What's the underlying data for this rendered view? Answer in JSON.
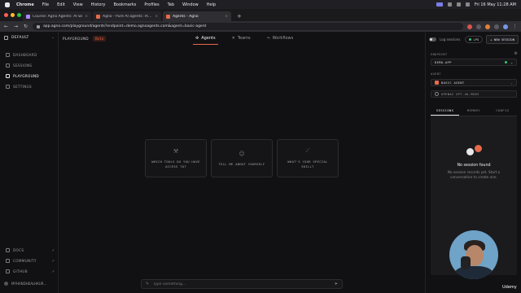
{
  "menubar": {
    "app": "Chrome",
    "items": [
      "File",
      "Edit",
      "View",
      "History",
      "Bookmarks",
      "Profiles",
      "Tab",
      "Window",
      "Help"
    ],
    "clock": "Fri 16 May  11:28 AM"
  },
  "browser": {
    "tabs": [
      {
        "title": "Course: Agno Agents: AI wi",
        "favicon_color": "#a78bfa"
      },
      {
        "title": "Agno - Pure AI agents: made",
        "favicon_color": "#e66a4a"
      },
      {
        "title": "Agents - Agno",
        "favicon_color": "#e66a4a",
        "active": true
      }
    ],
    "url": "app.agno.com/playground/agents?endpoint=demo.agnoagents.com&agent=basic-agent"
  },
  "sidebar": {
    "workspace": "DEFAULT",
    "nav": [
      {
        "label": "DASHBOARD",
        "icon": "grid-icon"
      },
      {
        "label": "SESSIONS",
        "icon": "history-icon"
      },
      {
        "label": "PLAYGROUND",
        "icon": "play-icon",
        "active": true
      },
      {
        "label": "SETTINGS",
        "icon": "gear-icon"
      }
    ],
    "links": [
      {
        "label": "DOCS",
        "icon": "docs-icon"
      },
      {
        "label": "COMMUNITY",
        "icon": "community-icon"
      },
      {
        "label": "GITHUB",
        "icon": "github-icon"
      }
    ],
    "user": "MYHANDHEALHKUR..."
  },
  "main": {
    "section": "PLAYGROUND",
    "badge": "Beta",
    "tabs": [
      {
        "label": "Agents",
        "icon": "agents-icon",
        "active": true
      },
      {
        "label": "Teams",
        "icon": "teams-icon"
      },
      {
        "label": "Workflows",
        "icon": "workflows-icon"
      }
    ],
    "suggestions": [
      {
        "text": "WHICH TOOLS DO YOU HAVE ACCESS TO?",
        "icon": "tools-icon"
      },
      {
        "text": "TELL ME ABOUT YOURSELF",
        "icon": "smile-icon"
      },
      {
        "text": "WHAT'S YOUR SPECIAL SKILL?",
        "icon": "sparkle-icon"
      }
    ],
    "chat_placeholder": "Type something..."
  },
  "right": {
    "log_sessions_label": "Log sessions",
    "status_pill": "LPS",
    "new_session": "+ NEW SESSION",
    "endpoint_label": "ENDPOINT",
    "endpoint_value": "DEMO-APP",
    "agent_label": "AGENT",
    "agent_value": "BASIC AGENT",
    "model_value": "OPENAI GPT-4O-MINI",
    "subtabs": [
      {
        "label": "SESSIONS",
        "active": true
      },
      {
        "label": "MEMORY"
      },
      {
        "label": "CONFIG"
      }
    ],
    "empty_title": "No session found",
    "empty_sub": "No session records yet. Start a conversation to create one."
  },
  "overlay": {
    "brand": "Udemy"
  }
}
